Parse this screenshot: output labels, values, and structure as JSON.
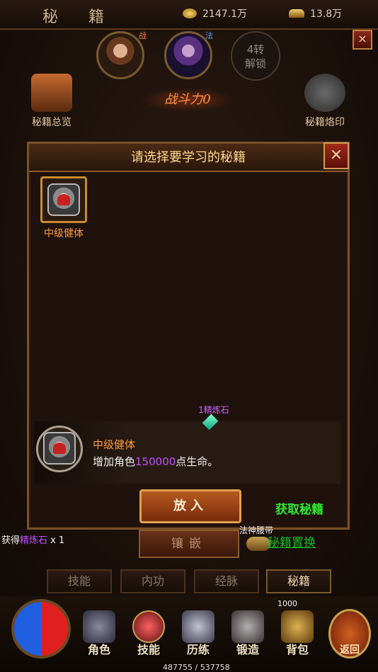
{
  "header": {
    "title": "秘 籍",
    "gold": "2147.1万",
    "ingots": "13.8万"
  },
  "characters": {
    "warrior_tag": "战",
    "mage_tag": "法",
    "unlock_label": "4转\n解锁"
  },
  "side": {
    "overview_label": "秘籍总览",
    "seal_label": "秘籍烙印"
  },
  "power_label": "战斗力0",
  "modal": {
    "title": "请选择要学习的秘籍",
    "close": "×",
    "slot_label": "中级健体",
    "gem_label": "1精炼石",
    "info_name": "中级健体",
    "info_desc_prefix": "增加角色",
    "info_desc_value": "150000",
    "info_desc_suffix": "点生命。",
    "put_button": "放入",
    "get_link": "获取秘籍"
  },
  "below": {
    "embed_button": "镶嵌",
    "belt_label": "法神腰带",
    "reset_link": "秘籍置换",
    "loot_prefix": "获得",
    "loot_item": "精炼石",
    "loot_suffix": "x 1"
  },
  "subtabs": [
    "技能",
    "内功",
    "经脉",
    "秘籍"
  ],
  "nav": {
    "items": [
      "角色",
      "技能",
      "历练",
      "锻造",
      "背包"
    ],
    "return_label": "返回",
    "exp": "487755 / 537758",
    "level": "1000"
  },
  "colors": {
    "accent_orange": "#ff9a3a",
    "link_green": "#2ee830",
    "highlight_purple": "#c050ff"
  }
}
